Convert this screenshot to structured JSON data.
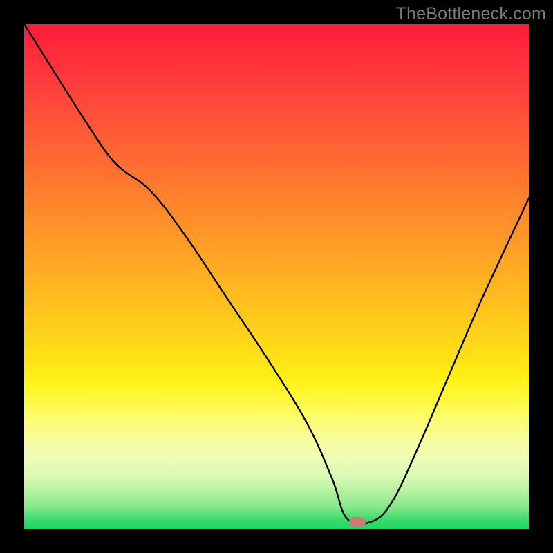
{
  "watermark": "TheBottleneck.com",
  "marker": {
    "x_frac": 0.66,
    "y_frac": 0.986
  },
  "chart_data": {
    "type": "line",
    "title": "",
    "xlabel": "",
    "ylabel": "",
    "xlim": [
      0,
      1
    ],
    "ylim": [
      0,
      1
    ],
    "note": "Axes are unlabeled; values are fractional (0–1) positions read off the plot area. y is fraction from top (0 = top of gradient / red, 1 = bottom / green).",
    "series": [
      {
        "name": "curve",
        "x": [
          0.0,
          0.06,
          0.12,
          0.18,
          0.25,
          0.32,
          0.4,
          0.48,
          0.56,
          0.61,
          0.64,
          0.69,
          0.73,
          0.78,
          0.84,
          0.9,
          0.96,
          1.0
        ],
        "y": [
          0.0,
          0.095,
          0.19,
          0.275,
          0.33,
          0.42,
          0.54,
          0.66,
          0.79,
          0.9,
          0.98,
          0.985,
          0.945,
          0.84,
          0.7,
          0.56,
          0.43,
          0.345
        ]
      }
    ],
    "marker_point": {
      "x": 0.66,
      "y": 0.986
    },
    "gradient_stops": [
      {
        "pos": 0.0,
        "color": "#ff1a3a"
      },
      {
        "pos": 0.5,
        "color": "#ffaa24"
      },
      {
        "pos": 0.72,
        "color": "#fff83a"
      },
      {
        "pos": 1.0,
        "color": "#18d862"
      }
    ]
  }
}
